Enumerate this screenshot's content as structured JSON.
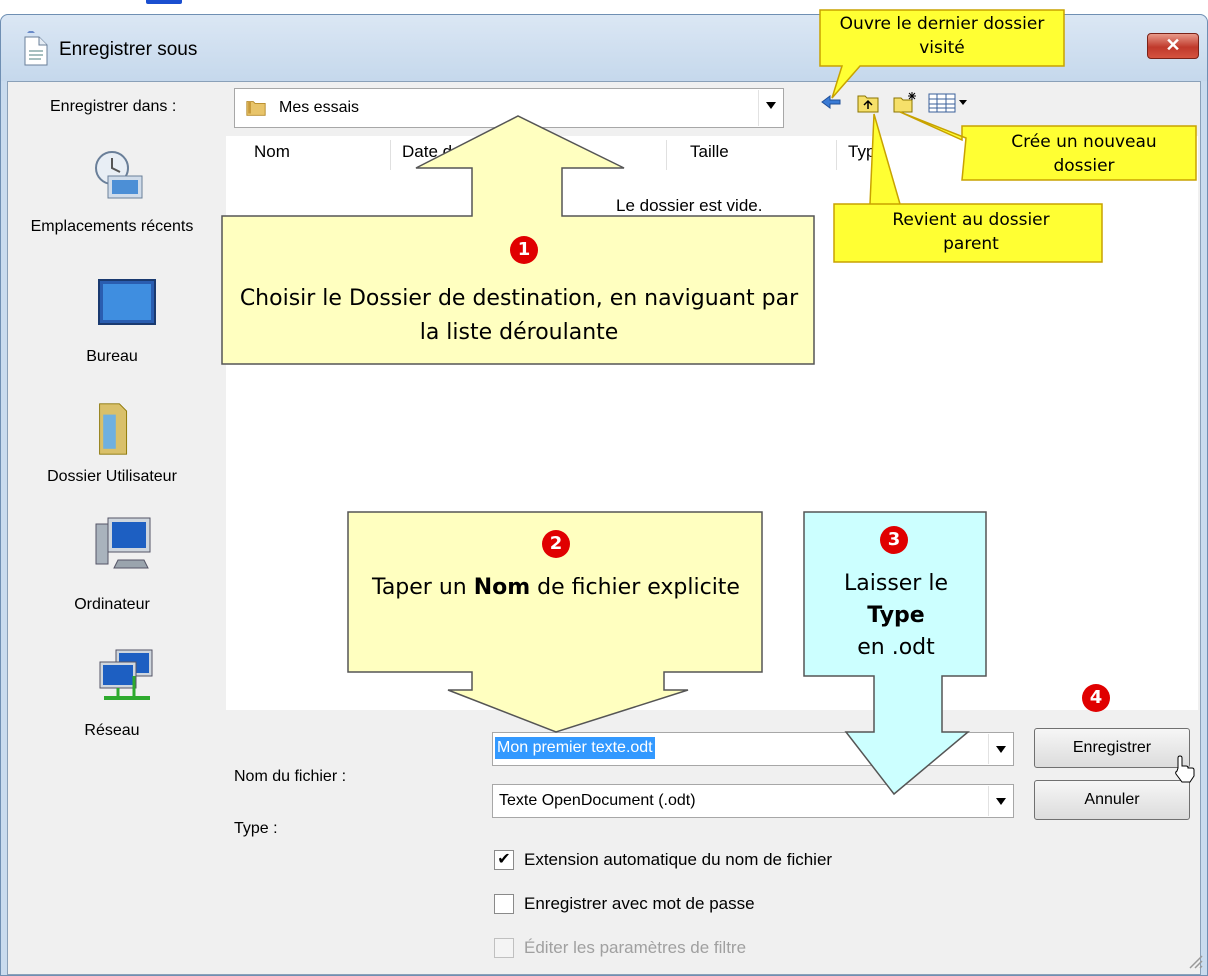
{
  "window": {
    "title": "Enregistrer sous",
    "close_label": "✕"
  },
  "save_in": {
    "label": "Enregistrer dans :",
    "value": "Mes essais"
  },
  "places": [
    {
      "label": "Emplacements récents",
      "icon": "recent-places-icon"
    },
    {
      "label": "Bureau",
      "icon": "desktop-icon"
    },
    {
      "label": "Dossier Utilisateur",
      "icon": "user-folder-icon"
    },
    {
      "label": "Ordinateur",
      "icon": "computer-icon"
    },
    {
      "label": "Réseau",
      "icon": "network-icon"
    }
  ],
  "toolbar": {
    "icons": [
      "back-arrow-icon",
      "parent-folder-icon",
      "new-folder-icon",
      "view-menu-icon"
    ]
  },
  "filelist": {
    "columns": [
      "Nom",
      "Date de modification",
      "Taille",
      "Type"
    ],
    "empty_text": "Le dossier est vide."
  },
  "form": {
    "filename_label": "Nom du fichier :",
    "filename_value": "Mon premier texte.odt",
    "type_label": "Type :",
    "type_value": "Texte OpenDocument (.odt)"
  },
  "buttons": {
    "save": "Enregistrer",
    "cancel": "Annuler"
  },
  "options": [
    {
      "label": "Extension automatique du nom de fichier",
      "checked": true,
      "enabled": true
    },
    {
      "label": "Enregistrer avec mot de passe",
      "checked": false,
      "enabled": true
    },
    {
      "label": "Éditer les paramètres de filtre",
      "checked": false,
      "enabled": false
    }
  ],
  "annotations": {
    "last_folder": "Ouvre le dernier dossier visité",
    "new_folder": "Crée un nouveau dossier",
    "parent_folder": "Revient au dossier parent",
    "step1_num": "1",
    "step1": "Choisir le Dossier de destination, en naviguant par la liste déroulante",
    "step2_num": "2",
    "step2_pre": "Taper un ",
    "step2_bold": "Nom",
    "step2_post": " de fichier explicite",
    "step3_num": "3",
    "step3_pre": "Laisser le",
    "step3_bold": "Type",
    "step3_post": "en .odt",
    "step4_num": "4"
  },
  "colors": {
    "callout_yellow": "#ffffc0",
    "note_yellow": "#ffff33",
    "callout_cyan": "#ccffff",
    "step_red": "#e00000",
    "selection_blue": "#3399ff"
  }
}
